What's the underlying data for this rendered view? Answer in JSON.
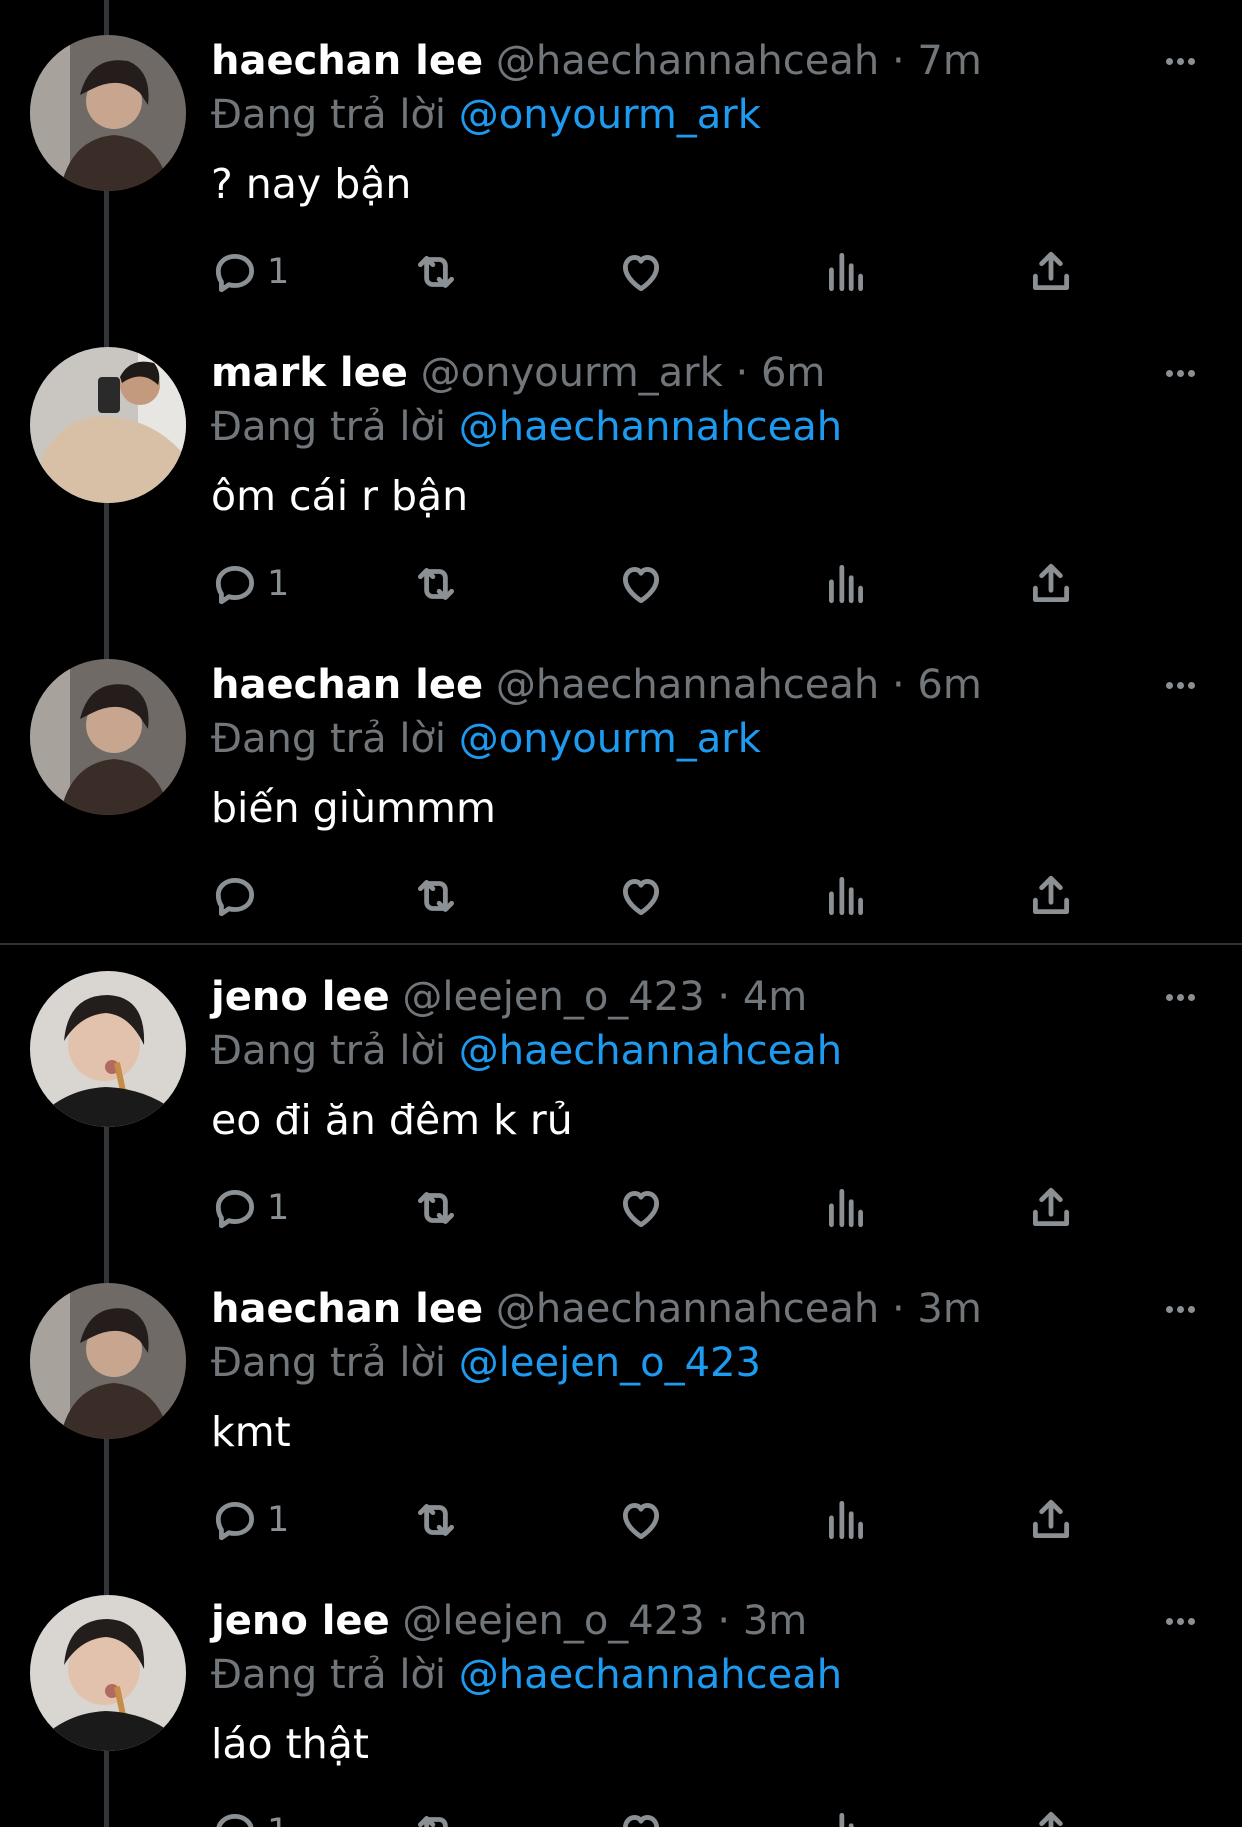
{
  "colors": {
    "background": "#000000",
    "mention": "#1d9bf0",
    "muted": "#71767b",
    "divider": "#2f3336"
  },
  "reply_prefix": "Đang trả lời",
  "tweets": [
    {
      "name": "haechan lee",
      "handle": "@haechannahceah",
      "dot": "·",
      "time": "7m",
      "reply_to": "@onyourm_ark",
      "text": "? nay bận",
      "reply_count": "1",
      "avatar": "haechan-avatar"
    },
    {
      "name": "mark lee",
      "handle": "@onyourm_ark",
      "dot": "·",
      "time": "6m",
      "reply_to": "@haechannahceah",
      "text": "ôm cái r bận",
      "reply_count": "1",
      "avatar": "mark-avatar"
    },
    {
      "name": "haechan lee",
      "handle": "@haechannahceah",
      "dot": "·",
      "time": "6m",
      "reply_to": "@onyourm_ark",
      "text": "biến giùmmm",
      "reply_count": "",
      "avatar": "haechan-avatar"
    },
    {
      "name": "jeno lee",
      "handle": "@leejen_o_423",
      "dot": "·",
      "time": "4m",
      "reply_to": "@haechannahceah",
      "text": "eo đi ăn đêm k rủ",
      "reply_count": "1",
      "avatar": "jeno-avatar"
    },
    {
      "name": "haechan lee",
      "handle": "@haechannahceah",
      "dot": "·",
      "time": "3m",
      "reply_to": "@leejen_o_423",
      "text": "kmt",
      "reply_count": "1",
      "avatar": "haechan-avatar"
    },
    {
      "name": "jeno lee",
      "handle": "@leejen_o_423",
      "dot": "·",
      "time": "3m",
      "reply_to": "@haechannahceah",
      "text": "láo thật",
      "reply_count": "1",
      "avatar": "jeno-avatar"
    }
  ]
}
